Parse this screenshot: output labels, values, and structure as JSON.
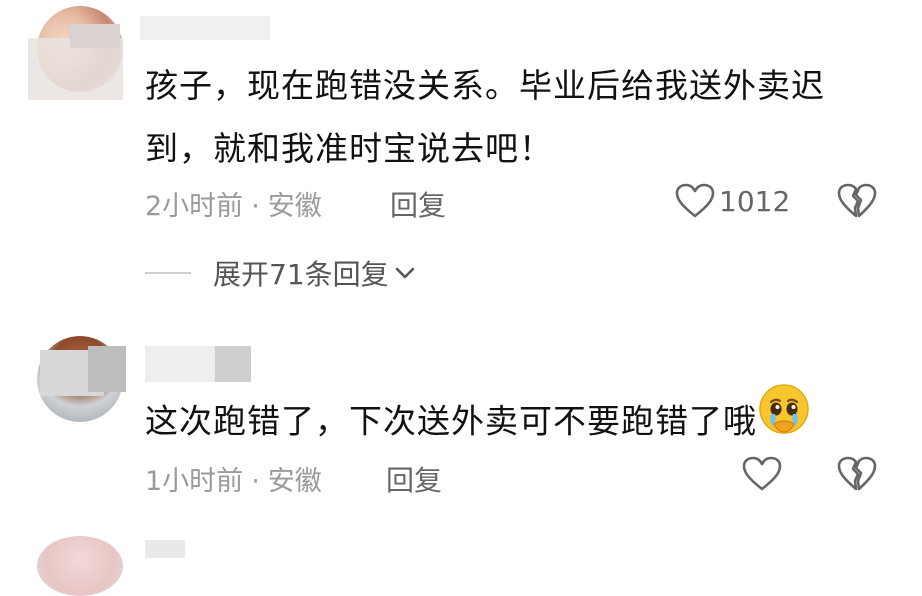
{
  "comments": [
    {
      "text": "孩子，现在跑错没关系。毕业后给我送外卖迟到，就和我准时宝说去吧！",
      "time": "2小时前",
      "location": "安徽",
      "reply_label": "回复",
      "likes": "1012",
      "expand_label": "展开71条回复",
      "icons": {
        "like": "heart-outline-icon",
        "dislike": "broken-heart-icon",
        "expand": "chevron-down-icon"
      }
    },
    {
      "text": "这次跑错了，下次送外卖可不要跑错了哦",
      "emoji": "crying-face-emoji",
      "time": "1小时前",
      "location": "安徽",
      "reply_label": "回复",
      "icons": {
        "like": "heart-outline-icon",
        "dislike": "broken-heart-icon"
      }
    }
  ],
  "separator": "·"
}
